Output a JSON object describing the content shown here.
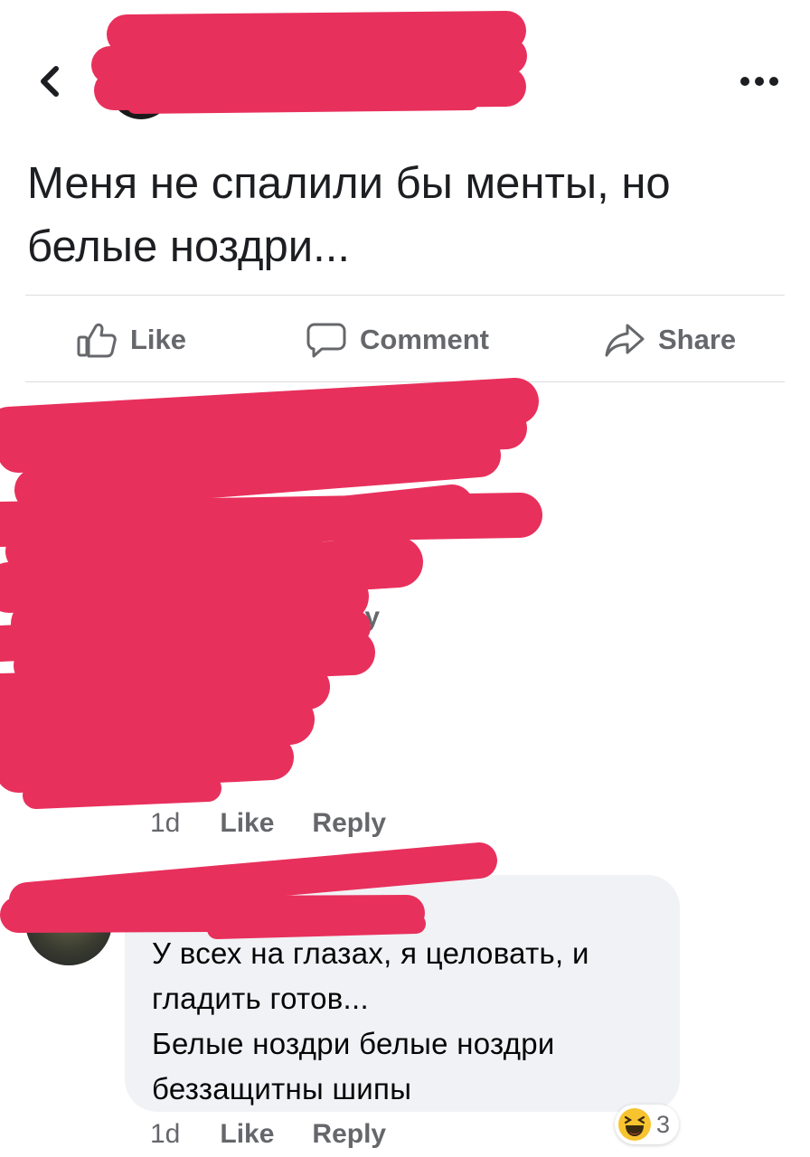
{
  "post": {
    "text_line1": "Меня не спалили бы менты, но",
    "text_line2": "белые ноздри..."
  },
  "actions": {
    "like": "Like",
    "comment": "Comment",
    "share": "Share"
  },
  "comments": [
    {
      "time": "1d",
      "like": "Like",
      "reply": "Reply",
      "reply_fragment": "eply"
    },
    {
      "text_lines": [
        "У всех на глазах, я целовать, и",
        "гладить готов...",
        "Белые ноздри белые ноздри",
        "беззащитны шипы"
      ],
      "time": "1d",
      "like": "Like",
      "reply": "Reply",
      "reaction_icon": "haha-emoji-icon",
      "reaction_count": "3"
    }
  ],
  "colors": {
    "censor": "#e8305c",
    "meta_gray": "#65676b",
    "bubble": "#f0f2f5"
  }
}
